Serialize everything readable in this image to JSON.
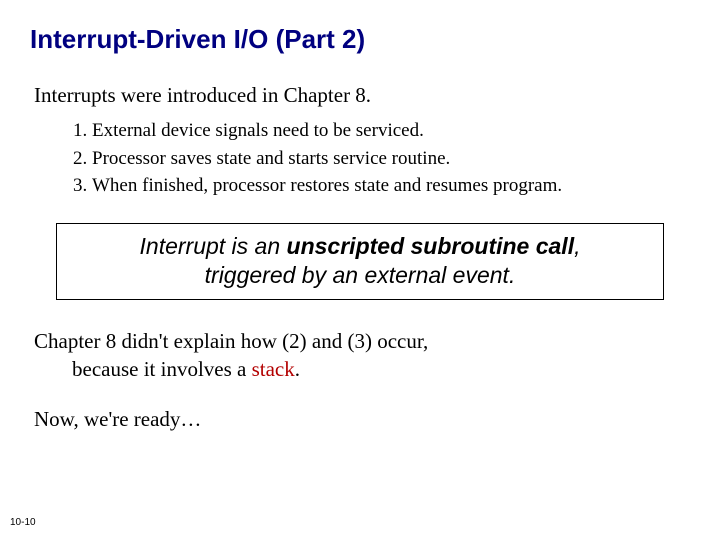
{
  "title": "Interrupt-Driven I/O (Part 2)",
  "intro": "Interrupts were introduced in Chapter 8.",
  "list": {
    "item1": "External device signals need to be serviced.",
    "item2": "Processor saves state and starts service routine.",
    "item3": "When finished, processor restores state and resumes program."
  },
  "callout": {
    "line1_pre": "Interrupt is an ",
    "line1_bold": "unscripted subroutine call",
    "line1_post": ",",
    "line2": "triggered by an external event."
  },
  "para2_a": "Chapter 8 didn't explain how (2) and (3) occur,",
  "para2_b_pre": "because it involves a ",
  "para2_b_red": "stack",
  "para2_b_post": ".",
  "ready": "Now, we're ready…",
  "pagenum": "10-10"
}
